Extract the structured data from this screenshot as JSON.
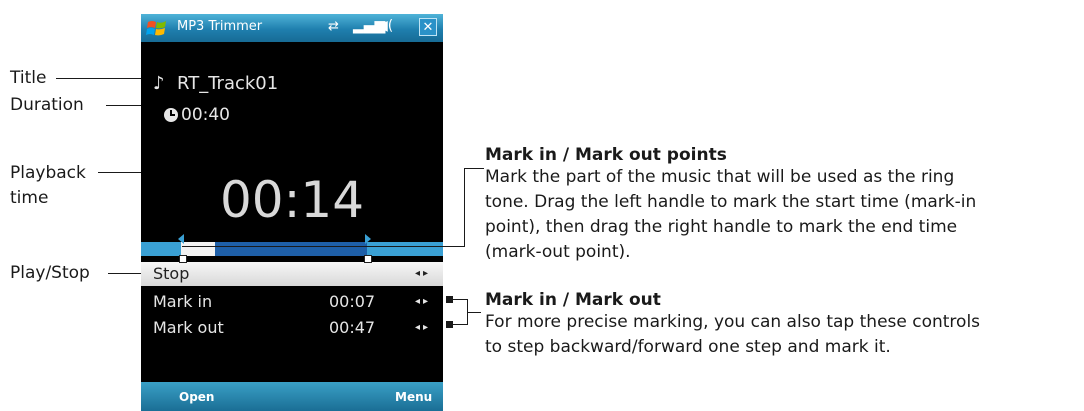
{
  "app": {
    "title": "MP3 Trimmer",
    "status_icons": [
      "sync-icon",
      "signal-icon",
      "volume-icon"
    ],
    "close_label": "✕"
  },
  "track": {
    "name": "RT_Track01",
    "duration": "00:40",
    "playback_time": "00:14"
  },
  "controls": {
    "stop_label": "Stop",
    "mark_in_label": "Mark in",
    "mark_in_time": "00:07",
    "mark_out_label": "Mark out",
    "mark_out_time": "00:47",
    "arrows": "◂▸"
  },
  "softkeys": {
    "left": "Open",
    "right": "Menu"
  },
  "callouts": {
    "title": "Title",
    "duration": "Duration",
    "playback_line1": "Playback",
    "playback_line2": "time",
    "play_stop": "Play/Stop"
  },
  "descriptions": {
    "points_title": "Mark in / Mark out points",
    "points_lines": [
      "Mark the part of the music that will be used as the ring",
      "tone. Drag the left handle to mark the start time (mark-in",
      "point), then drag the right handle to mark the end time",
      "(mark-out point)."
    ],
    "mark_title": "Mark in / Mark out",
    "mark_lines": [
      "For more precise marking, you can also tap these controls",
      "to step backward/forward one step and mark it."
    ]
  },
  "colors": {
    "titlebar": "#1f7fae",
    "accent_blue": "#3aa0d4",
    "range_blue": "#1e5fa8",
    "background": "#000000"
  }
}
